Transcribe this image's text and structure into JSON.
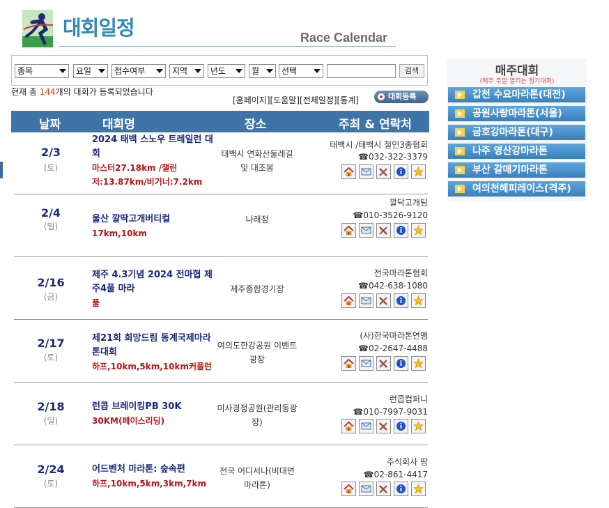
{
  "header": {
    "title_ko": "대회일정",
    "title_en": "Race Calendar"
  },
  "search": {
    "filters": [
      "종목",
      "요일",
      "접수여부",
      "지역",
      "년도",
      "월",
      "선택"
    ],
    "input_value": "",
    "button_label": "검색"
  },
  "summary": {
    "prefix": "현재 총 ",
    "count": "144",
    "suffix": "개의 대회가 등록되었습니다"
  },
  "links": {
    "homepage": "[홈페이지]",
    "help": "[도움말]",
    "all": "[전체일정]",
    "stats": "[통계]",
    "register": "대회등록"
  },
  "table": {
    "headers": [
      "날짜",
      "대회명",
      "장소",
      "주최 & 연락처"
    ],
    "rows": [
      {
        "date": "2/3",
        "dow": "(토)",
        "name": "2024 태백 스노우 트레일런 대회",
        "distance": "마스터27.18km /챌린저:13.87km/비기너:7.2km",
        "place": "태백시 연화산둘레길 및 대조봉",
        "org": "태백시 /태백시 철인3종협회",
        "phone": "☎032-322-3379"
      },
      {
        "date": "2/4",
        "dow": "(일)",
        "name": "울산 깔딱고개버티컬",
        "distance": "17km,10km",
        "place": "나래정",
        "org": "깔닥고개팀",
        "phone": "☎010-3526-9120"
      },
      {
        "date": "2/16",
        "dow": "(금)",
        "name": "제주 4.3기념 2024 전마협 제주4풀 마라",
        "distance": "풀",
        "place": "제주종합경기장",
        "org": "전국마라톤협회",
        "phone": "☎042-638-1080"
      },
      {
        "date": "2/17",
        "dow": "(토)",
        "name": "제21회 희망드림 동계국제마라톤대회",
        "distance": "하프,10km,5km,10km커플런",
        "place": "여의도한강공원 이벤트광장",
        "org": "(사)한국마라톤연맹",
        "phone": "☎02-2647-4488"
      },
      {
        "date": "2/18",
        "dow": "(일)",
        "name": "런콥 브레이킹PB 30K",
        "distance": "30KM(페이스리딩)",
        "place": "미사경정공원(관리동광장)",
        "org": "런콥컴퍼니",
        "phone": "☎010-7997-9031"
      },
      {
        "date": "2/24",
        "dow": "(토)",
        "name": "어드벤처 마라톤: 숲속편",
        "distance": "하프,10km,5km,3km,7km",
        "place": "전국 어디서나(비대면 마라톤)",
        "org": "주식회사 땀",
        "phone": "☎02-861-4417"
      }
    ]
  },
  "weekly": {
    "title": "매주대회",
    "subtitle": "(매주 주말 열리는 정기대회)",
    "items": [
      "갑천 수요마라톤(대전)",
      "공원사랑마라톤(서울)",
      "금호강마라톤(대구)",
      "나주 영산강마라톤",
      "부산 갈매기마라톤",
      "여의천헤피레이스(격주)"
    ]
  },
  "icons": [
    "home-icon",
    "email-icon",
    "tools-icon",
    "info-icon",
    "star-icon"
  ]
}
